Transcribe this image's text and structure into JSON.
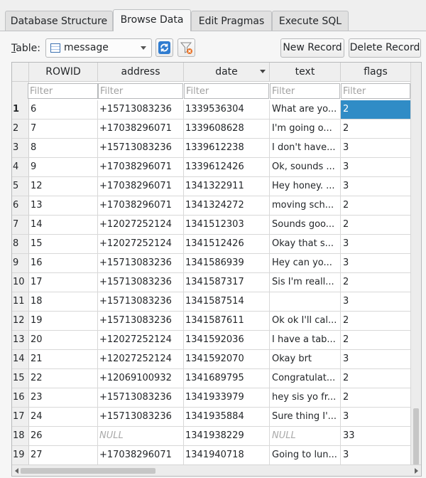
{
  "tabs": [
    {
      "label": "Database Structure"
    },
    {
      "label": "Browse Data"
    },
    {
      "label": "Edit Pragmas"
    },
    {
      "label": "Execute SQL"
    }
  ],
  "toolbar": {
    "table_label_u": "T",
    "table_label_rest": "able:",
    "table_name": "message",
    "new_record": "New Record",
    "delete_record": "Delete Record"
  },
  "grid": {
    "columns": [
      "ROWID",
      "address",
      "date",
      "text",
      "flags"
    ],
    "filter_placeholder": "Filter",
    "rows": [
      {
        "n": "1",
        "rowid": "6",
        "address": "+15713083236",
        "date": "1339536304",
        "text": "What are yo...",
        "flags": "2"
      },
      {
        "n": "2",
        "rowid": "7",
        "address": "+17038296071",
        "date": "1339608628",
        "text": "I'm going o...",
        "flags": "2"
      },
      {
        "n": "3",
        "rowid": "8",
        "address": "+15713083236",
        "date": "1339612238",
        "text": "I don't have...",
        "flags": "3"
      },
      {
        "n": "4",
        "rowid": "9",
        "address": "+17038296071",
        "date": "1339612426",
        "text": "Ok, sounds ...",
        "flags": "3"
      },
      {
        "n": "5",
        "rowid": "12",
        "address": "+17038296071",
        "date": "1341322911",
        "text": "Hey honey. ...",
        "flags": "3"
      },
      {
        "n": "6",
        "rowid": "13",
        "address": "+17038296071",
        "date": "1341324272",
        "text": "moving sch...",
        "flags": "2"
      },
      {
        "n": "7",
        "rowid": "14",
        "address": "+12027252124",
        "date": "1341512303",
        "text": "Sounds goo...",
        "flags": "2"
      },
      {
        "n": "8",
        "rowid": "15",
        "address": "+12027252124",
        "date": "1341512426",
        "text": "Okay that s...",
        "flags": "3"
      },
      {
        "n": "9",
        "rowid": "16",
        "address": "+15713083236",
        "date": "1341586939",
        "text": "Hey can yo...",
        "flags": "3"
      },
      {
        "n": "10",
        "rowid": "17",
        "address": "+15713083236",
        "date": "1341587317",
        "text": "Sis I'm reall...",
        "flags": "2"
      },
      {
        "n": "11",
        "rowid": "18",
        "address": "+15713083236",
        "date": "1341587514",
        "text": "",
        "flags": "3"
      },
      {
        "n": "12",
        "rowid": "19",
        "address": "+15713083236",
        "date": "1341587611",
        "text": "Ok ok I'll cal...",
        "flags": "2"
      },
      {
        "n": "13",
        "rowid": "20",
        "address": "+12027252124",
        "date": "1341592036",
        "text": "I have a tab...",
        "flags": "2"
      },
      {
        "n": "14",
        "rowid": "21",
        "address": "+12027252124",
        "date": "1341592070",
        "text": "Okay brt",
        "flags": "3"
      },
      {
        "n": "15",
        "rowid": "22",
        "address": "+12069100932",
        "date": "1341689795",
        "text": "Congratulat...",
        "flags": "2"
      },
      {
        "n": "16",
        "rowid": "23",
        "address": "+15713083236",
        "date": "1341933979",
        "text": "hey sis yo fr...",
        "flags": "2"
      },
      {
        "n": "17",
        "rowid": "24",
        "address": "+15713083236",
        "date": "1341935884",
        "text": "Sure thing I'...",
        "flags": "3"
      },
      {
        "n": "18",
        "rowid": "26",
        "address": "NULL",
        "date": "1341938229",
        "text": "NULL",
        "flags": "33"
      },
      {
        "n": "19",
        "rowid": "27",
        "address": "+17038296071",
        "date": "1341940718",
        "text": "Going to lun...",
        "flags": "3"
      }
    ]
  },
  "colors": {
    "selection": "#308cc6",
    "null_text": "#a9a9a9"
  }
}
